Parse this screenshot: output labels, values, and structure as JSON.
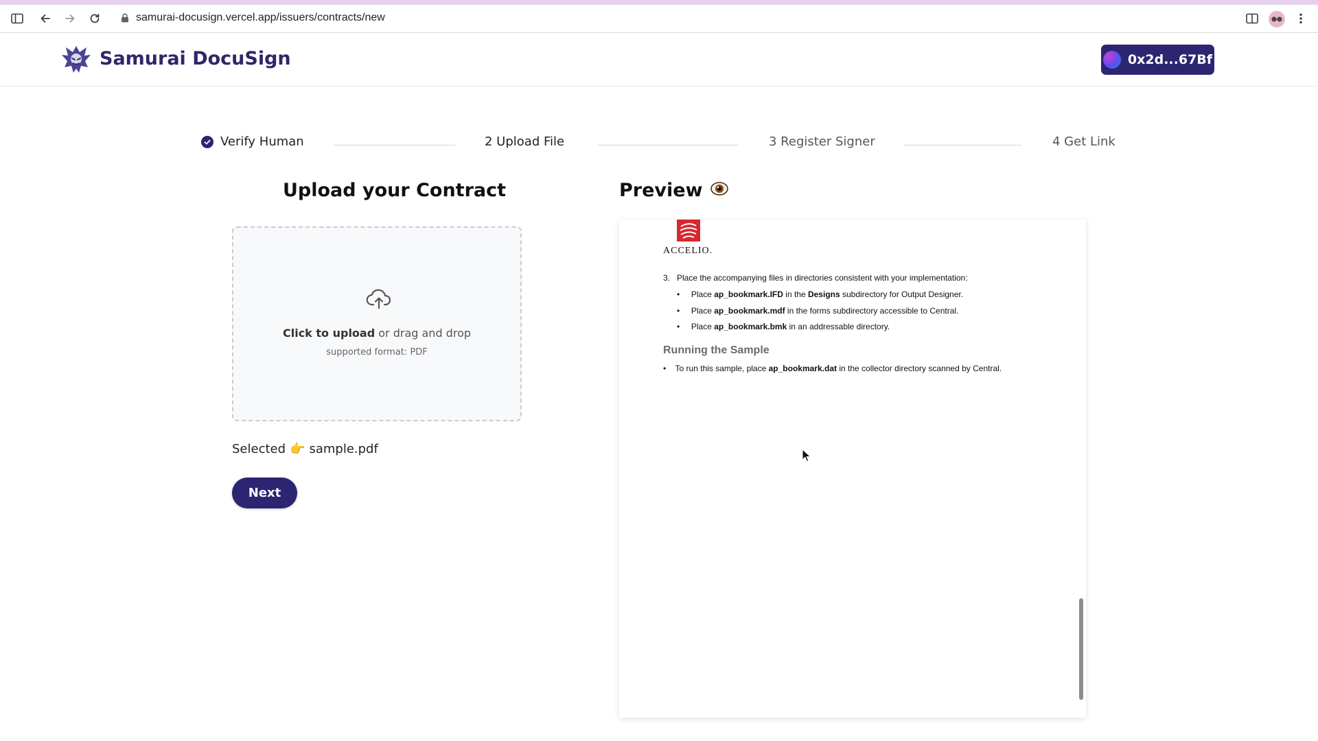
{
  "browser": {
    "url": "samurai-docusign.vercel.app/issuers/contracts/new",
    "icons": [
      "sidebar-toggle-icon",
      "back-arrow-icon",
      "forward-arrow-icon",
      "reload-icon",
      "lock-icon",
      "split-view-icon",
      "profile-avatar-icon",
      "more-menu-icon"
    ]
  },
  "header": {
    "app_name": "Samurai DocuSign",
    "wallet_address": "0x2d...67Bf"
  },
  "stepper": {
    "steps": [
      {
        "label": "Verify Human",
        "state": "completed"
      },
      {
        "label": "2 Upload File",
        "state": "active"
      },
      {
        "label": "3 Register Signer",
        "state": "pending"
      },
      {
        "label": "4 Get Link",
        "state": "pending"
      }
    ]
  },
  "upload": {
    "title": "Upload your Contract",
    "click_to_upload": "Click to upload",
    "drag_text": " or drag and drop",
    "supported_format": "supported format: PDF",
    "selected_label": "Selected",
    "selected_emoji": "👉",
    "selected_file": "sample.pdf",
    "next_label": "Next"
  },
  "preview": {
    "title": "Preview",
    "title_emoji": "👁️",
    "doc": {
      "logo_text": "ACCELIO.",
      "step_number": "3.",
      "step_text": "Place the accompanying files in directories consistent with your implementation:",
      "bullets": [
        {
          "pre": "Place ",
          "bold": "ap_bookmark.IFD",
          "mid": " in the ",
          "bold2": "Designs",
          "post": " subdirectory for Output Designer."
        },
        {
          "pre": "Place ",
          "bold": "ap_bookmark.mdf",
          "mid": " in the forms subdirectory accessible to Central.",
          "bold2": "",
          "post": ""
        },
        {
          "pre": "Place ",
          "bold": "ap_bookmark.bmk",
          "mid": " in an addressable directory.",
          "bold2": "",
          "post": ""
        }
      ],
      "section_heading": "Running the Sample",
      "run_bullet": {
        "pre": "To run this sample, place ",
        "bold": "ap_bookmark.dat",
        "post": " in the collector directory scanned by Central."
      }
    }
  },
  "colors": {
    "brand": "#2c2572",
    "logo_red": "#d6282e"
  }
}
